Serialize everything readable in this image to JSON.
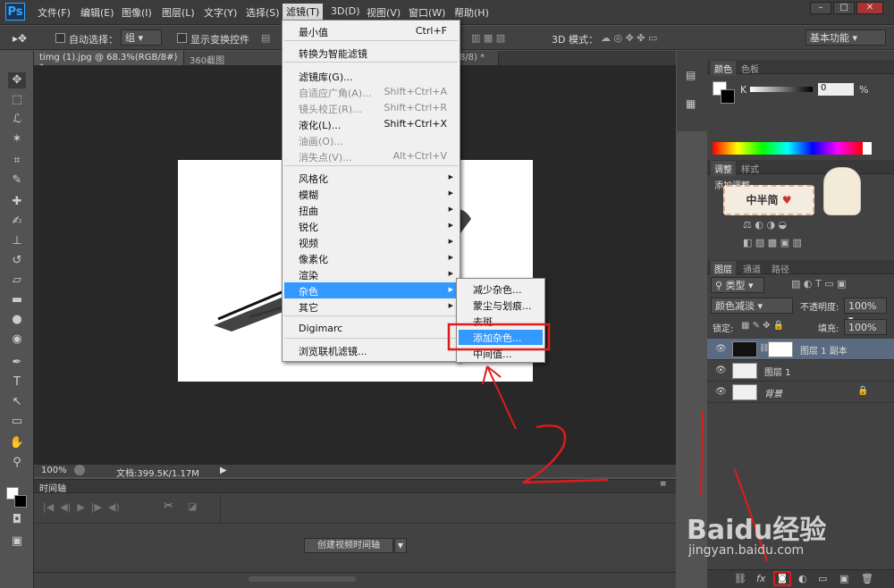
{
  "app": {
    "logo": "Ps"
  },
  "menubar": {
    "items": [
      "文件(F)",
      "编辑(E)",
      "图像(I)",
      "图层(L)",
      "文字(Y)",
      "选择(S)",
      "滤镜(T)",
      "3D(D)",
      "视图(V)",
      "窗口(W)",
      "帮助(H)"
    ]
  },
  "options": {
    "auto_select_label": "自动选择：",
    "auto_select_value": "组",
    "show_transform_label": "显示变换控件",
    "mode_3d_label": "3D 模式：",
    "workspace": "基本功能"
  },
  "tabs": [
    "timg (1).jpg @ 68.3%(RGB/8#) *",
    "360截图20191205170",
    "8/8) *"
  ],
  "filter_menu": {
    "items": [
      {
        "label": "最小值",
        "shortcut": "Ctrl+F",
        "disabled": false
      },
      {
        "label": "转换为智能滤镜",
        "shortcut": "",
        "disabled": false
      },
      {
        "label": "滤镜库(G)...",
        "shortcut": "",
        "disabled": false
      },
      {
        "label": "自适应广角(A)...",
        "shortcut": "Shift+Ctrl+A",
        "disabled": true
      },
      {
        "label": "镜头校正(R)...",
        "shortcut": "Shift+Ctrl+R",
        "disabled": true
      },
      {
        "label": "液化(L)...",
        "shortcut": "Shift+Ctrl+X",
        "disabled": false
      },
      {
        "label": "油画(O)...",
        "shortcut": "",
        "disabled": true
      },
      {
        "label": "消失点(V)...",
        "shortcut": "Alt+Ctrl+V",
        "disabled": true
      },
      {
        "label": "风格化",
        "shortcut": "",
        "disabled": false
      },
      {
        "label": "模糊",
        "shortcut": "",
        "disabled": false
      },
      {
        "label": "扭曲",
        "shortcut": "",
        "disabled": false
      },
      {
        "label": "锐化",
        "shortcut": "",
        "disabled": false
      },
      {
        "label": "视频",
        "shortcut": "",
        "disabled": false
      },
      {
        "label": "像素化",
        "shortcut": "",
        "disabled": false
      },
      {
        "label": "渲染",
        "shortcut": "",
        "disabled": false
      },
      {
        "label": "杂色",
        "shortcut": "",
        "disabled": false
      },
      {
        "label": "其它",
        "shortcut": "",
        "disabled": false
      },
      {
        "label": "Digimarc",
        "shortcut": "",
        "disabled": false
      },
      {
        "label": "浏览联机滤镜...",
        "shortcut": "",
        "disabled": false
      }
    ]
  },
  "noise_submenu": {
    "items": [
      "减少杂色...",
      "蒙尘与划痕...",
      "去斑",
      "添加杂色...",
      "中间值..."
    ]
  },
  "status": {
    "zoom": "100%",
    "doc": "文档:399.5K/1.17M"
  },
  "timeline": {
    "title": "时间轴",
    "create_button": "创建视频时间轴"
  },
  "color_panel": {
    "tab1": "颜色",
    "tab2": "色板",
    "channel": "K",
    "value": "0",
    "unit": "%"
  },
  "adjust_panel": {
    "tab1": "调整",
    "tab2": "样式",
    "add_label": "添加调整"
  },
  "layers_panel": {
    "tabs": [
      "图层",
      "通道",
      "路径"
    ],
    "kind": "类型",
    "blend_mode": "颜色减淡",
    "opacity_label": "不透明度:",
    "opacity": "100%",
    "lock_label": "锁定:",
    "fill_label": "填充:",
    "fill": "100%",
    "layers": [
      "图层 1 副本",
      "图层 1",
      "背景"
    ]
  },
  "annotations": {
    "step_number": "2"
  },
  "watermark": {
    "brand": "Baidu经验",
    "url": "jingyan.baidu.com",
    "sticker": "中半简"
  },
  "colors": {
    "highlight": "#3399ff",
    "annotation": "#e01b1b",
    "ui_dark": "#424242"
  }
}
